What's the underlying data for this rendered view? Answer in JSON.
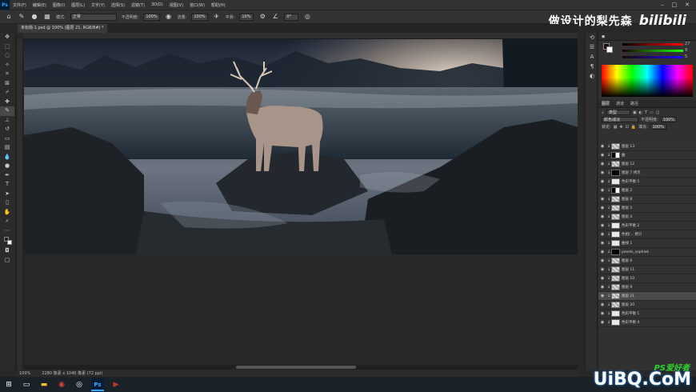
{
  "menu": [
    "文件(F)",
    "编辑(E)",
    "图像(I)",
    "图层(L)",
    "文字(Y)",
    "选择(S)",
    "滤镜(T)",
    "3D(D)",
    "视图(V)",
    "窗口(W)",
    "帮助(H)"
  ],
  "options": {
    "mode_label": "模式:",
    "mode_value": "正常",
    "opacity_label": "不透明度:",
    "opacity_value": "100%",
    "flow_label": "流量:",
    "flow_value": "100%",
    "smooth_label": "平滑:",
    "smooth_value": "10%",
    "angle_value": "0°"
  },
  "watermark": {
    "text": "做设计的梨先森",
    "logo": "bilibili"
  },
  "document": {
    "tab_title": "未标题-1.psd @ 100% (图层 21, RGB/8#) *"
  },
  "status": {
    "zoom": "100%",
    "doc_size": "2280 像素 x 1040 像素 (72 ppi)"
  },
  "color_panel": {
    "value_r": "27",
    "value_g": "9",
    "value_b": "5"
  },
  "layers_panel": {
    "tabs": [
      "图层",
      "通道",
      "路径"
    ],
    "filter_label": "类型",
    "blend_mode": "颜色减淡",
    "opacity_label": "不透明度:",
    "opacity_value": "100%",
    "lock_label": "锁定:",
    "fill_label": "填充:",
    "fill_value": "100%",
    "layers": [
      {
        "name": "图层 13",
        "thumb": "checker"
      },
      {
        "name": "曲",
        "thumb": "mask-mix"
      },
      {
        "name": "图层 12",
        "thumb": "checker"
      },
      {
        "name": "图层 7 拷贝",
        "thumb": "mask-black"
      },
      {
        "name": "色彩平衡 5",
        "thumb": "adj"
      },
      {
        "name": "图层 2",
        "thumb": "mask-mix"
      },
      {
        "name": "图层 8",
        "thumb": "checker"
      },
      {
        "name": "图层 5",
        "thumb": "checker"
      },
      {
        "name": "图层 4",
        "thumb": "checker"
      },
      {
        "name": "色彩平衡 2",
        "thumb": "adj"
      },
      {
        "name": "色相/... 拷贝",
        "thumb": "adj"
      },
      {
        "name": "曲线 1",
        "thumb": "adj"
      },
      {
        "name": "pexels_sophiek",
        "thumb": "mask-black"
      },
      {
        "name": "图层 6",
        "thumb": "checker"
      },
      {
        "name": "图层 11",
        "thumb": "checker"
      },
      {
        "name": "图层 10",
        "thumb": "checker"
      },
      {
        "name": "图层 9",
        "thumb": "checker"
      },
      {
        "name": "图层 21",
        "thumb": "checker",
        "selected": true
      },
      {
        "name": "图层 20",
        "thumb": "checker"
      },
      {
        "name": "色彩平衡 1",
        "thumb": "adj"
      },
      {
        "name": "色彩平衡 4",
        "thumb": "adj"
      }
    ]
  },
  "site_watermark": {
    "main": "UiBQ.CoM",
    "sub": "PS爱好者"
  }
}
